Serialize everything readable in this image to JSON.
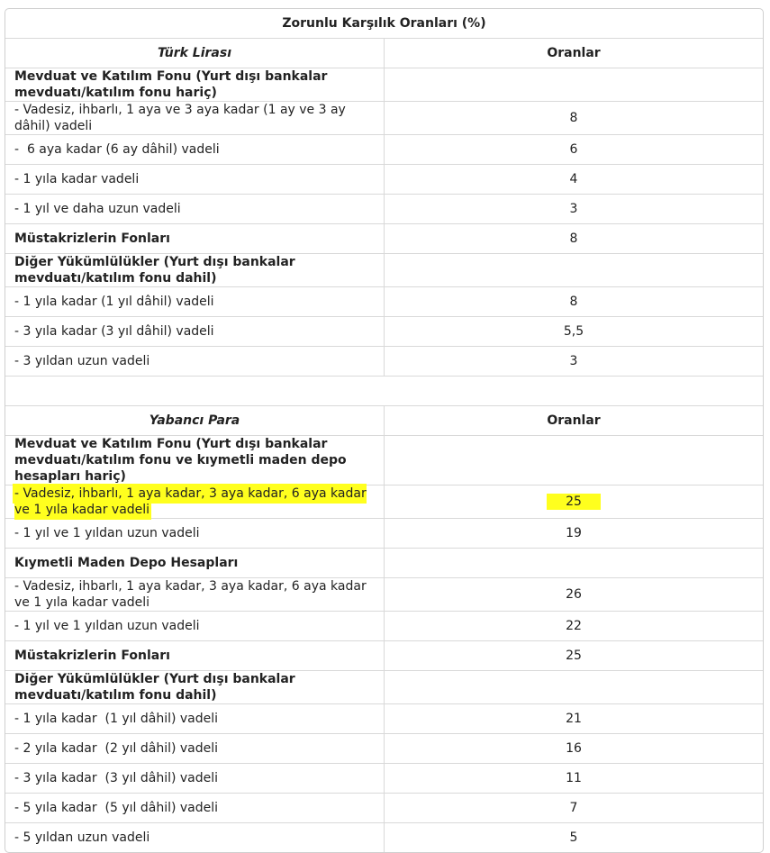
{
  "title": "Zorunlu Karşılık Oranları (%)",
  "rate_header": "Oranlar",
  "sections": {
    "tl": {
      "currency": "Türk Lirası",
      "rows": [
        {
          "label": "Mevduat ve Katılım Fonu (Yurt dışı bankalar mevduatı/katılım fonu hariç)",
          "rate": ""
        },
        {
          "label": "- Vadesiz, ihbarlı, 1 aya ve 3 aya kadar (1 ay ve 3 ay dâhil) vadeli",
          "rate": "8"
        },
        {
          "label": "-  6 aya kadar (6 ay dâhil) vadeli",
          "rate": "6"
        },
        {
          "label": "- 1 yıla kadar vadeli",
          "rate": "4"
        },
        {
          "label": "- 1 yıl ve daha uzun vadeli",
          "rate": "3"
        },
        {
          "label": "Müstakrizlerin Fonları",
          "rate": "8"
        },
        {
          "label": "Diğer Yükümlülükler (Yurt dışı bankalar mevduatı/katılım fonu dahil)",
          "rate": ""
        },
        {
          "label": "- 1 yıla kadar (1 yıl dâhil) vadeli",
          "rate": "8"
        },
        {
          "label": "- 3 yıla kadar (3 yıl dâhil) vadeli",
          "rate": "5,5"
        },
        {
          "label": "- 3 yıldan uzun vadeli",
          "rate": "3"
        }
      ]
    },
    "fx": {
      "currency": "Yabancı Para",
      "rows": [
        {
          "label": "Mevduat ve Katılım Fonu (Yurt dışı bankalar mevduatı/katılım fonu ve kıymetli maden depo hesapları hariç)",
          "rate": ""
        },
        {
          "label": "- Vadesiz, ihbarlı, 1 aya kadar, 3 aya kadar, 6 aya kadar ve 1 yıla kadar vadeli",
          "rate": "25"
        },
        {
          "label": "- 1 yıl ve 1 yıldan uzun vadeli",
          "rate": "19"
        },
        {
          "label": "Kıymetli Maden Depo Hesapları",
          "rate": ""
        },
        {
          "label": "- Vadesiz, ihbarlı, 1 aya kadar, 3 aya kadar, 6 aya kadar ve 1 yıla kadar vadeli",
          "rate": "26"
        },
        {
          "label": "- 1 yıl ve 1 yıldan uzun vadeli",
          "rate": "22"
        },
        {
          "label": "Müstakrizlerin Fonları",
          "rate": "25"
        },
        {
          "label": "Diğer Yükümlülükler (Yurt dışı bankalar mevduatı/katılım fonu dahil)",
          "rate": ""
        },
        {
          "label": "- 1 yıla kadar  (1 yıl dâhil) vadeli",
          "rate": "21"
        },
        {
          "label": "- 2 yıla kadar  (2 yıl dâhil) vadeli",
          "rate": "16"
        },
        {
          "label": "- 3 yıla kadar  (3 yıl dâhil) vadeli",
          "rate": "11"
        },
        {
          "label": "- 5 yıla kadar  (5 yıl dâhil) vadeli",
          "rate": "7"
        },
        {
          "label": "- 5 yıldan uzun vadeli",
          "rate": "5"
        }
      ]
    }
  },
  "highlight_color": "#ffff1e"
}
